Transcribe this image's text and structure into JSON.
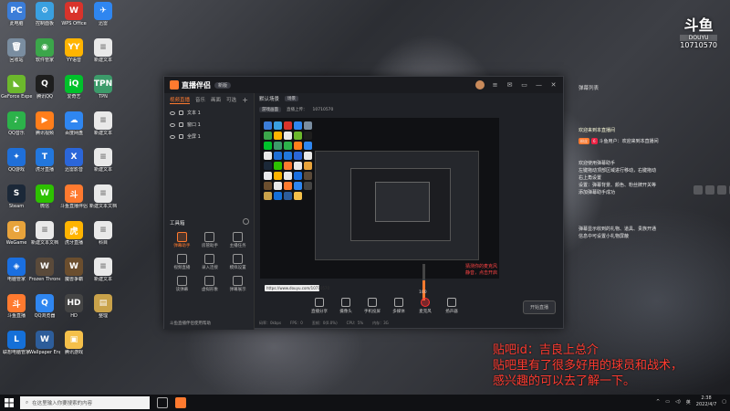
{
  "desktop": {
    "icons": [
      {
        "label": "此电脑",
        "color": "#3b7dd8",
        "glyph": "PC"
      },
      {
        "label": "控制面板",
        "color": "#3aa0e0",
        "glyph": "⚙"
      },
      {
        "label": "WPS Office",
        "color": "#d9332b",
        "glyph": "W"
      },
      {
        "label": "迅雷",
        "color": "#2f86f0",
        "glyph": "✈"
      },
      {
        "label": "回收站",
        "color": "#7a8da0",
        "glyph": "🗑"
      },
      {
        "label": "软件管家",
        "color": "#3ba64a",
        "glyph": "◉"
      },
      {
        "label": "YY语音",
        "color": "#ffb400",
        "glyph": "YY"
      },
      {
        "label": "新建文本",
        "color": "#e9e9e9",
        "glyph": "≡"
      },
      {
        "label": "GeForce Experience",
        "color": "#6cb82c",
        "glyph": "◣"
      },
      {
        "label": "腾讯QQ",
        "color": "#1e1e1e",
        "glyph": "Q"
      },
      {
        "label": "爱奇艺",
        "color": "#00c12b",
        "glyph": "iQ"
      },
      {
        "label": "TPN",
        "color": "#3c9b6a",
        "glyph": "TPN"
      },
      {
        "label": "QQ音乐",
        "color": "#2cb24a",
        "glyph": "♪"
      },
      {
        "label": "腾讯视频",
        "color": "#ff7e1b",
        "glyph": "▶"
      },
      {
        "label": "百度网盘",
        "color": "#2f86f0",
        "glyph": "☁"
      },
      {
        "label": "新建文本",
        "color": "#e9e9e9",
        "glyph": "≡"
      },
      {
        "label": "QQ游戏",
        "color": "#1f6fd8",
        "glyph": "✦"
      },
      {
        "label": "虎牙直播",
        "color": "#2277dd",
        "glyph": "T"
      },
      {
        "label": "迅雷影音",
        "color": "#2b66d9",
        "glyph": "X"
      },
      {
        "label": "新建文本",
        "color": "#e9e9e9",
        "glyph": "≡"
      },
      {
        "label": "Steam",
        "color": "#1b2838",
        "glyph": "S"
      },
      {
        "label": "微信",
        "color": "#2dc100",
        "glyph": "W"
      },
      {
        "label": "斗鱼直播伴侣",
        "color": "#ff7a2f",
        "glyph": "斗"
      },
      {
        "label": "新建文本文档",
        "color": "#e9e9e9",
        "glyph": "≡"
      },
      {
        "label": "WeGame",
        "color": "#e8a33b",
        "glyph": "G"
      },
      {
        "label": "新建文本文档",
        "color": "#e9e9e9",
        "glyph": "≡"
      },
      {
        "label": "虎牙直播",
        "color": "#ffb400",
        "glyph": "虎"
      },
      {
        "label": "科目",
        "color": "#e9e9e9",
        "glyph": "≡"
      },
      {
        "label": "电脑管家",
        "color": "#1a6fe0",
        "glyph": "◈"
      },
      {
        "label": "Frozen Throne",
        "color": "#5a4a3a",
        "glyph": "W"
      },
      {
        "label": "魔兽争霸",
        "color": "#6b4e2e",
        "glyph": "W"
      },
      {
        "label": "新建文本",
        "color": "#e9e9e9",
        "glyph": "≡"
      },
      {
        "label": "斗鱼直播",
        "color": "#ff7a2f",
        "glyph": "斗"
      },
      {
        "label": "QQ浏览器",
        "color": "#2f86f0",
        "glyph": "Q"
      },
      {
        "label": "HD",
        "color": "#444",
        "glyph": "HD"
      },
      {
        "label": "整理",
        "color": "#c9a24a",
        "glyph": "▤"
      },
      {
        "label": "联想电脑管家",
        "color": "#1570d8",
        "glyph": "L"
      },
      {
        "label": "Wallpaper Engine",
        "color": "#2d5d9a",
        "glyph": "W"
      },
      {
        "label": "腾讯游戏",
        "color": "#f5c04a",
        "glyph": "▣"
      }
    ]
  },
  "app": {
    "title": "直播伴侣",
    "version": "新版",
    "left_tabs": [
      "视频直播",
      "音乐",
      "画面",
      "可选"
    ],
    "sources": [
      "文本 1",
      "窗口 1",
      "全屏 1"
    ],
    "tools_title": "工具箱",
    "tools": [
      {
        "label": "弹幕助手",
        "active": true
      },
      {
        "label": "房管助手",
        "active": false
      },
      {
        "label": "主播任务",
        "active": false
      },
      {
        "label": "视频直播",
        "active": false
      },
      {
        "label": "录入连接",
        "active": false
      },
      {
        "label": "模拟设置",
        "active": false
      },
      {
        "label": "读弹幕",
        "active": false
      },
      {
        "label": "虚拟形象",
        "active": false
      },
      {
        "label": "弹幕展示",
        "active": false
      }
    ],
    "bottom_note": "斗鱼直播伴侣使用帮助",
    "scene_label": "默认场景",
    "scene_badge": "场景",
    "sub_items": [
      "游戏画面",
      "直播上传：",
      "10710570"
    ],
    "preview_url": "https://www.douyu.com/10710570",
    "volume_value": "100",
    "red_note": [
      "猜测你的麦克风",
      "静音，点击开启"
    ],
    "controls": [
      "直播分享",
      "摄像头",
      "手机投屏",
      "多媒体",
      "麦克风",
      "扬声器"
    ],
    "golive_label": "开始直播",
    "stats": [
      "码率：0kbps",
      "FPS：0",
      "丢帧：0(0.0%)",
      "CPU：5%",
      "内存：3G"
    ],
    "window_buttons": [
      "≡",
      "✉",
      "▭",
      "—",
      "✕"
    ]
  },
  "chat": {
    "header": "弹幕列表",
    "messages": [
      {
        "text": "欢迎来到本直播间",
        "type": "sys"
      },
      {
        "tag": "粉丝",
        "tag2": "6",
        "name": "斗鱼用户：",
        "text": "欢迎来到本直播间"
      },
      {
        "text": "欢迎使用弹幕助手",
        "type": "plain"
      },
      {
        "text": "左键拖动顶部区域进行移动，右键拖动",
        "type": "plain"
      },
      {
        "text": "右上角设置",
        "type": "plain"
      },
      {
        "text": "设置：弹幕背景、颜色、粉丝牌开关等",
        "type": "plain"
      },
      {
        "text": "添加弹幕助手成功",
        "type": "plain"
      },
      {
        "text": "弹幕显示收到的礼物、道具、贵族开通",
        "type": "plain"
      },
      {
        "text": "信息中可设置小礼物屏蔽",
        "type": "plain"
      }
    ]
  },
  "watermark": {
    "brand": "斗鱼",
    "sub": "DOUYU",
    "room": "10710570"
  },
  "overlay_text": [
    "贴吧id：吉良上总介",
    "贴吧里有了很多好用的球员和战术，",
    "感兴趣的可以去了解一下。"
  ],
  "taskbar": {
    "search_placeholder": "在这里输入你要搜索的内容",
    "time": "2:38",
    "date": "2022/4/7",
    "ime": "英"
  }
}
